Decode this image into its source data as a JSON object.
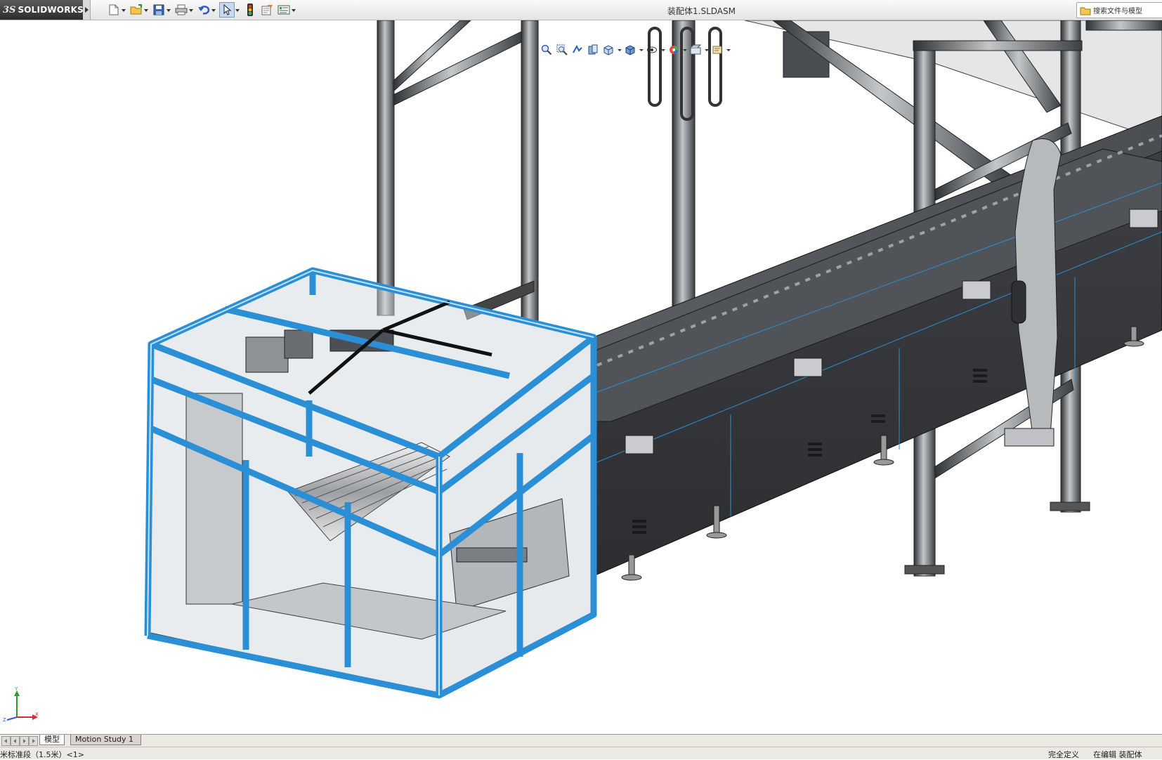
{
  "app": {
    "logo_ds": "3S",
    "logo_text": "SOLIDWORKS",
    "document_title": "装配体1.SLDASM"
  },
  "toolbar": {
    "buttons": [
      "new-document",
      "open",
      "save",
      "print",
      "undo",
      "select",
      "rebuild",
      "file-properties",
      "options"
    ]
  },
  "search": {
    "placeholder": "搜索文件与模型"
  },
  "headsup": {
    "icons": [
      "zoom-to-fit",
      "zoom-to-area",
      "previous-view",
      "section-view",
      "view-orientation",
      "display-style",
      "hide-show-items",
      "edit-appearance",
      "apply-scene",
      "view-settings"
    ]
  },
  "tabs": {
    "model": "模型",
    "motion": "Motion Study 1"
  },
  "status": {
    "left": "米标准段（1.5米）<1>",
    "definition": "完全定义",
    "editing": "在编辑 装配体"
  },
  "colors": {
    "frame_blue": "#2b8fd6",
    "steel": "#5b5f63",
    "dark_panel": "#3b3d41",
    "glass": "#cfd6dc"
  },
  "triad": {
    "x": "X",
    "y": "Y",
    "z": "Z"
  }
}
